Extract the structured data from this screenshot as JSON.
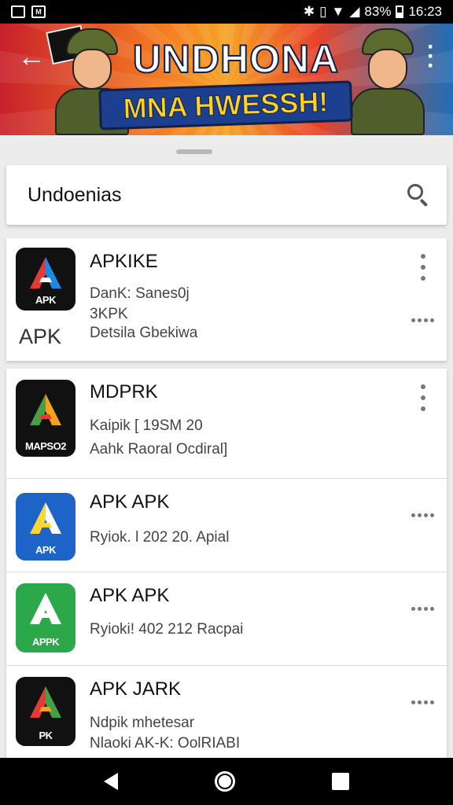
{
  "status_bar": {
    "icons_left": [
      "image-notification-icon",
      "gmail-icon"
    ],
    "battery": "83%",
    "time": "16:23"
  },
  "banner": {
    "title": "UNDHONA",
    "subtitle": "MNA HWESSH!"
  },
  "search": {
    "value": "Undoenias"
  },
  "apps": [
    {
      "name": "APKIKE",
      "lines": [
        "DanK: Sanes0j",
        "3KPK",
        "Detsila Gbekiwa"
      ],
      "apk_tag": "APK",
      "icon_label": "APK",
      "icon_bg": "#111111",
      "icon_colors": [
        "#e53935",
        "#1e88e5",
        "#ffffff"
      ]
    },
    {
      "name": "MDPRK",
      "lines": [
        "Kaipik [ 19SM 20",
        "Aahk Raoral Ocdiral]"
      ],
      "icon_label": "MAPSO2",
      "icon_bg": "#111111",
      "icon_colors": [
        "#43a047",
        "#f4a21e",
        "#e53935"
      ]
    },
    {
      "name": "APK APK",
      "lines": [
        "Ryiok. l 202 20. Apial"
      ],
      "icon_label": "APK",
      "icon_bg": "#1e63c8",
      "icon_colors": [
        "#fdd835",
        "#ffffff",
        "#fdd835"
      ]
    },
    {
      "name": "APK APK",
      "lines": [
        "Ryioki! 402 212 Racpai"
      ],
      "icon_label": "APPK",
      "icon_bg": "#2aa84a",
      "icon_colors": [
        "#ffffff",
        "#ffffff",
        "#ffffff"
      ]
    },
    {
      "name": "APK JARK",
      "lines": [
        "Ndpik mhetesar",
        "Nlaoki AK-K: OolRIABI"
      ],
      "icon_label": "PK",
      "icon_bg": "#111111",
      "icon_colors": [
        "#e53935",
        "#43a047",
        "#f4a21e"
      ]
    }
  ]
}
